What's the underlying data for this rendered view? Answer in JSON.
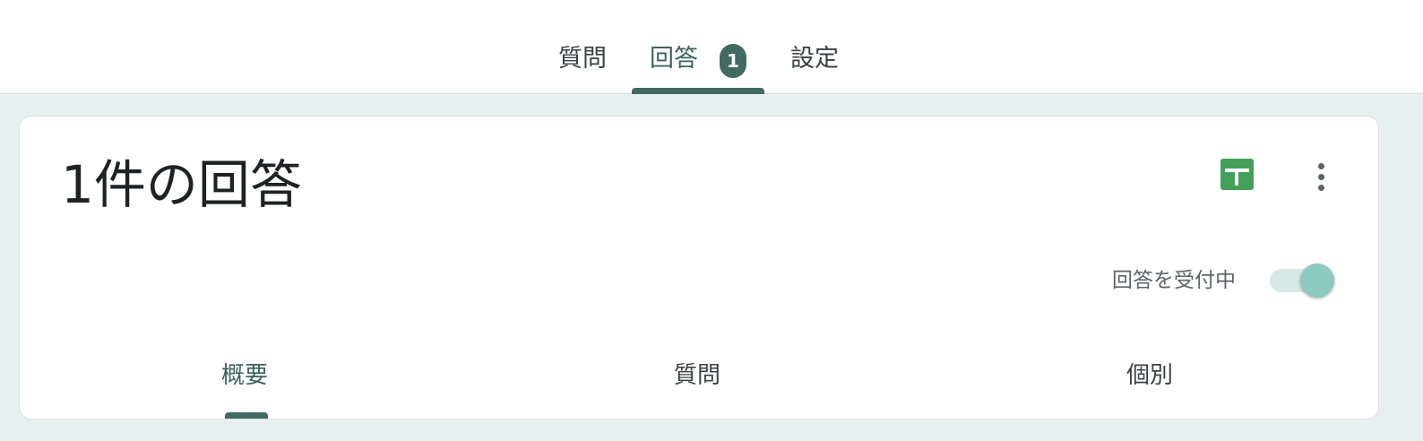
{
  "top_tabs": [
    {
      "label": "質問",
      "active": false
    },
    {
      "label": "回答",
      "active": true,
      "badge": "1"
    },
    {
      "label": "設定",
      "active": false
    }
  ],
  "card": {
    "title": "1件の回答",
    "sheets_icon": "spreadsheet-plus-icon",
    "more_icon": "more-vert-icon",
    "accepting_label": "回答を受付中",
    "accepting_on": true
  },
  "sub_tabs": [
    {
      "label": "概要",
      "active": true
    },
    {
      "label": "質問",
      "active": false
    },
    {
      "label": "個別",
      "active": false
    }
  ],
  "colors": {
    "accent": "#436a62",
    "background": "#e6f1ef",
    "sheets_green": "#43a05a",
    "toggle_thumb": "#8dcabf"
  }
}
